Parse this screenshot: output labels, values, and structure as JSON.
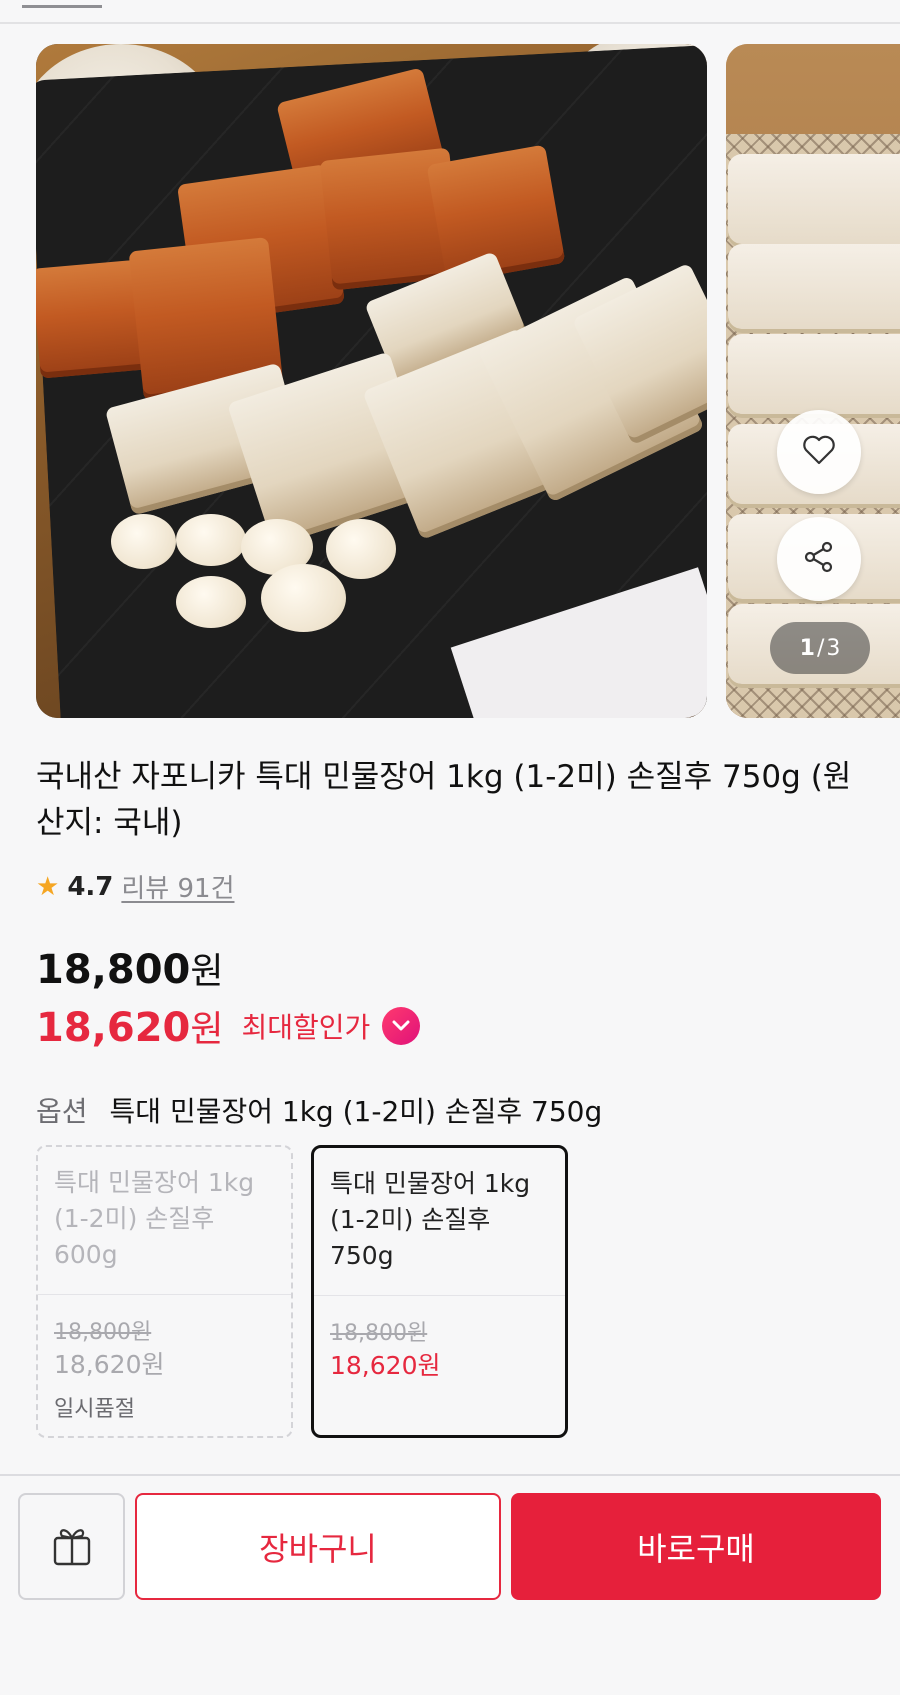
{
  "carousel": {
    "current": "1",
    "separator": "/",
    "total": "3"
  },
  "product": {
    "title": "국내산 자포니카 특대 민물장어 1kg (1-2미) 손질후 750g (원산지: 국내)",
    "rating": "4.7",
    "review_label": "리뷰 91건"
  },
  "price": {
    "original": "18,800",
    "original_unit": "원",
    "sale": "18,620",
    "sale_unit": "원",
    "max_discount_label": "최대할인가"
  },
  "option": {
    "label": "옵션",
    "selected_value": "특대 민물장어 1kg (1-2미) 손질후 750g",
    "choices": [
      {
        "name": "특대 민물장어 1kg (1-2미) 손질후 600g",
        "original_price": "18,800원",
        "sale_price": "18,620원",
        "status": "일시품절"
      },
      {
        "name": "특대 민물장어 1kg (1-2미) 손질후 750g",
        "original_price": "18,800원",
        "sale_price": "18,620원"
      }
    ]
  },
  "actions": {
    "cart_label": "장바구니",
    "buy_label": "바로구매"
  },
  "icons": {
    "heart": "heart-icon",
    "share": "share-icon",
    "gift": "gift-icon",
    "chevron": "chevron-down-icon",
    "star": "star-icon"
  },
  "colors": {
    "accent": "#e6283f",
    "buy_button": "#e6203b",
    "star": "#f5a623"
  }
}
